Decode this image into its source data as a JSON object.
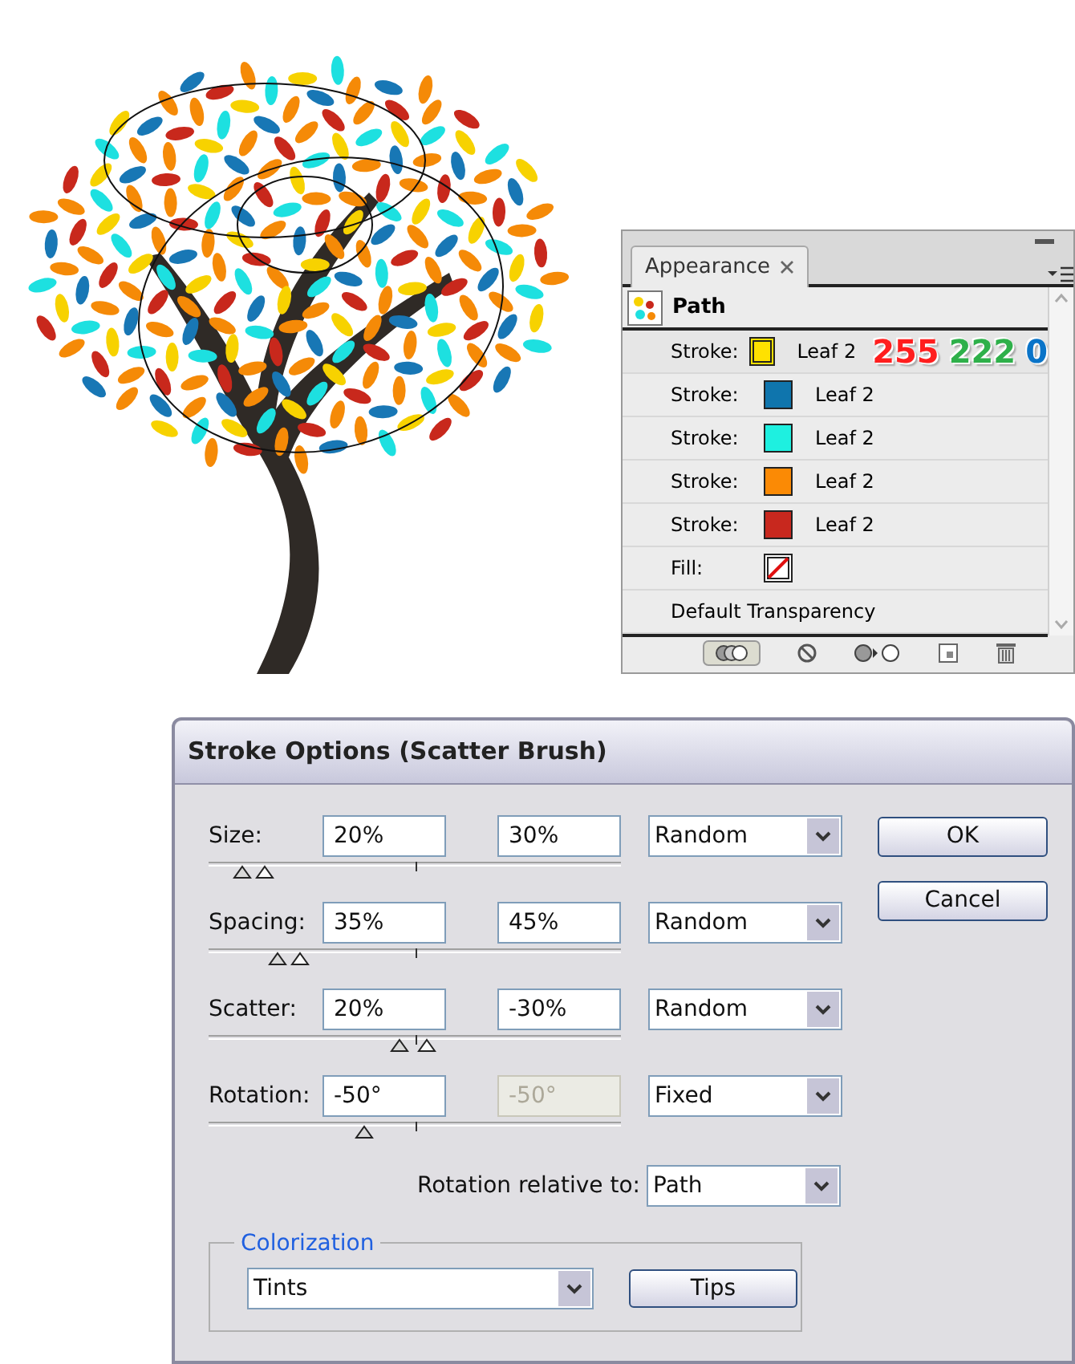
{
  "appearance_panel": {
    "tab": "Appearance",
    "header": "Path",
    "items": [
      {
        "kind": "stroke",
        "label": "Stroke:",
        "color": "#ffe100",
        "selected": true,
        "value": "Leaf 2"
      },
      {
        "kind": "stroke",
        "label": "Stroke:",
        "color": "#0f75ad",
        "selected": false,
        "value": "Leaf 2"
      },
      {
        "kind": "stroke",
        "label": "Stroke:",
        "color": "#1ef0e0",
        "selected": false,
        "value": "Leaf 2"
      },
      {
        "kind": "stroke",
        "label": "Stroke:",
        "color": "#fb8a05",
        "selected": false,
        "value": "Leaf 2"
      },
      {
        "kind": "stroke",
        "label": "Stroke:",
        "color": "#c8281e",
        "selected": false,
        "value": "Leaf 2"
      },
      {
        "kind": "fill",
        "label": "Fill:"
      },
      {
        "kind": "text",
        "label": "Default Transparency"
      }
    ],
    "rgb_readout": [
      {
        "text": "255",
        "color": "#ff1e1e"
      },
      {
        "text": "222",
        "color": "#2eb04a"
      },
      {
        "text": "0",
        "color": "#0a74c8"
      }
    ]
  },
  "dialog": {
    "title": "Stroke Options (Scatter Brush)",
    "rows": [
      {
        "label": "Size:",
        "min": "20%",
        "max": "30%",
        "max_disabled": false,
        "mode": "Random",
        "thumbs": [
          {
            "level": 0.06
          },
          {
            "level": 0.12
          }
        ]
      },
      {
        "label": "Spacing:",
        "min": "35%",
        "max": "45%",
        "max_disabled": false,
        "mode": "Random",
        "thumbs": [
          {
            "level": 0.15
          },
          {
            "level": 0.21
          }
        ]
      },
      {
        "label": "Scatter:",
        "min": "20%",
        "max": "-30%",
        "max_disabled": false,
        "mode": "Random",
        "thumbs": [
          {
            "level": 0.46
          },
          {
            "level": 0.53
          }
        ]
      },
      {
        "label": "Rotation:",
        "min": "-50°",
        "max": "-50°",
        "max_disabled": true,
        "mode": "Fixed",
        "thumbs": [
          {
            "level": 0.37
          }
        ]
      }
    ],
    "rotation_relative": {
      "label": "Rotation relative to:",
      "value": "Path"
    },
    "colorization": {
      "legend": "Colorization",
      "method": "Tints",
      "tips": "Tips"
    },
    "buttons": [
      "OK",
      "Cancel"
    ]
  }
}
